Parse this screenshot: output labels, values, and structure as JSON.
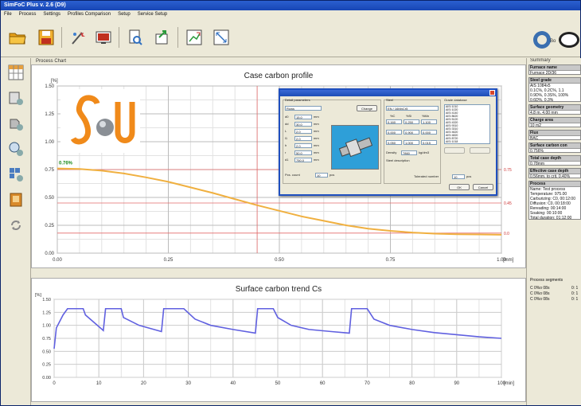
{
  "window": {
    "title": "SimFoC Plus v. 2.6 (D9)"
  },
  "menu": [
    "File",
    "Process",
    "Settings",
    "Profiles Comparison",
    "Setup",
    "Service Setup"
  ],
  "main": {
    "label": "Process Chart"
  },
  "summary": {
    "title": "Summary",
    "sections": [
      {
        "head": "Furnace name",
        "values": [
          "Furnace 2D/36"
        ]
      },
      {
        "head": "Steel grade",
        "values": [
          "AlS 1084x5",
          "0.1C%, 0.2C%, 1.1",
          "0.9D%, 0.3S%, 100%",
          "0.6D%, 0.3%"
        ]
      },
      {
        "head": "Surface geometry",
        "values": [
          "4.8 m, 4.00 mm"
        ]
      },
      {
        "head": "Charge area",
        "values": [
          "10 m2"
        ]
      },
      {
        "head": "Flux",
        "values": [
          "BAC"
        ]
      },
      {
        "head": "Surface carbon con",
        "values": [
          "0.756%"
        ]
      },
      {
        "head": "Total case depth",
        "values": [
          "0.78mm"
        ]
      },
      {
        "head": "Effective case depth",
        "values": [
          "0.56mm, to crit. 0.40%"
        ]
      },
      {
        "head": "Process",
        "values": [
          "Name: Test process",
          "Temperature: 975.00",
          "Carburizing: C0, 00:12:00",
          "Diffusion: C0, 00:18:00",
          "Rereading: 00:14:00",
          "Soaking: 00:10:00",
          "Total duration: 01:12:00"
        ]
      }
    ],
    "segments_label": "Process segments",
    "segments": [
      "C 0%o 08s",
      "C 0%o 08s",
      "C 0%o 08s"
    ],
    "segment_flags": [
      "0: 1",
      "0: 1",
      "0: 1"
    ]
  },
  "chart1": {
    "title": "Case carbon profile",
    "yunit": "[%]",
    "xunit": "[mm]",
    "yticks": [
      "1.50",
      "1.25",
      "1.00",
      "0.75",
      "0.50",
      "0.25",
      "0.00"
    ],
    "xticks": [
      "0.00",
      "0.25",
      "0.50",
      "0.75",
      "1.00"
    ],
    "annotation": "0.76%",
    "right_markers": [
      "0.75",
      "0.45",
      "0.0"
    ]
  },
  "chart2": {
    "title": "Surface carbon trend Cs",
    "yunit": "[%]",
    "xunit": "[min]",
    "yticks": [
      "1.50",
      "1.25",
      "1.00",
      "0.75",
      "0.50",
      "0.25",
      "0.00"
    ],
    "xticks": [
      "0",
      "10",
      "20",
      "30",
      "40",
      "50",
      "60",
      "70",
      "80",
      "90",
      "100"
    ]
  },
  "chart_data": [
    {
      "type": "line",
      "title": "Case carbon profile",
      "xlabel": "[mm]",
      "ylabel": "[%]",
      "xlim": [
        0,
        1.0
      ],
      "ylim": [
        0,
        1.5
      ],
      "grid": true,
      "series": [
        {
          "x": [
            0.0,
            0.05,
            0.1,
            0.15,
            0.2,
            0.25,
            0.3,
            0.35,
            0.4,
            0.45,
            0.5,
            0.55,
            0.6,
            0.65,
            0.7,
            0.75,
            0.8,
            0.85,
            0.9,
            0.95,
            1.0
          ],
          "y": [
            0.76,
            0.755,
            0.74,
            0.715,
            0.68,
            0.64,
            0.59,
            0.54,
            0.485,
            0.43,
            0.38,
            0.33,
            0.29,
            0.25,
            0.22,
            0.2,
            0.185,
            0.175,
            0.17,
            0.168,
            0.165
          ]
        }
      ],
      "reference_lines": [
        0.75,
        0.45,
        0.18
      ],
      "vertical_marker": 0.45,
      "annotation": "0.76%"
    },
    {
      "type": "line",
      "title": "Surface carbon trend Cs",
      "xlabel": "[min]",
      "ylabel": "[%]",
      "xlim": [
        0,
        100
      ],
      "ylim": [
        0,
        1.5
      ],
      "grid": true,
      "series": [
        {
          "x": [
            0,
            0.5,
            2,
            3,
            6.5,
            7,
            9,
            11,
            11.5,
            13.5,
            15,
            15.5,
            19,
            24,
            24.5,
            26.5,
            29,
            31.5,
            35,
            40,
            45,
            45.5,
            47.5,
            49,
            50,
            53,
            57,
            62,
            66,
            66.5,
            68.5,
            70,
            71.5,
            75,
            80,
            85,
            90,
            95,
            100
          ],
          "y": [
            0.55,
            0.95,
            1.2,
            1.32,
            1.32,
            1.2,
            1.05,
            0.9,
            1.32,
            1.32,
            1.32,
            1.15,
            1.0,
            0.88,
            1.32,
            1.32,
            1.32,
            1.12,
            1.0,
            0.92,
            0.85,
            1.32,
            1.32,
            1.32,
            1.15,
            1.0,
            0.92,
            0.88,
            0.85,
            1.32,
            1.32,
            1.32,
            1.12,
            1.0,
            0.92,
            0.86,
            0.82,
            0.78,
            0.75
          ]
        }
      ]
    }
  ],
  "dialog": {
    "group_left": "Detail parameters",
    "change_label": "Change",
    "param_labels": [
      "d0",
      "dd",
      "L",
      "l1",
      "h",
      "r",
      "d1"
    ],
    "param_values": [
      "15.0",
      "30.0",
      "2.0",
      "2.0",
      "2.0",
      "50.0",
      "750.0"
    ],
    "param_unit": "mm",
    "rows_label": "Rows",
    "count_label": "Pcs. count",
    "count_value": "10",
    "count_unit": "pcs",
    "steel_group": "Steel",
    "steel_value": "EN / 16MnCr5",
    "grid_headers": [
      "%C",
      "%Si",
      "%Mn"
    ],
    "grid_values": [
      "0.160",
      "0.250",
      "1.100",
      "0.000",
      "0.900",
      "0.000",
      "0.050",
      "1.000",
      "0.015"
    ],
    "density_label": "Density",
    "density_value": "7860",
    "density_unit": "kg/dm3",
    "desc_label": "Steel description",
    "db_label": "Grade database",
    "db_items": [
      "AISI 1010",
      "AISI 1020",
      "AISI 4140",
      "AISI 8620",
      "AISI 5120",
      "AISI 4320",
      "AISI 9310",
      "AISI 3310",
      "AISI 4620",
      "AISI 4820",
      "AISI 8720",
      "AISI 1018"
    ],
    "tolerance_label": "Tolerated number",
    "tolerance_value": "10",
    "tolerance_unit": "pcs",
    "ok_label": "OK",
    "cancel_label": "Cancel"
  }
}
